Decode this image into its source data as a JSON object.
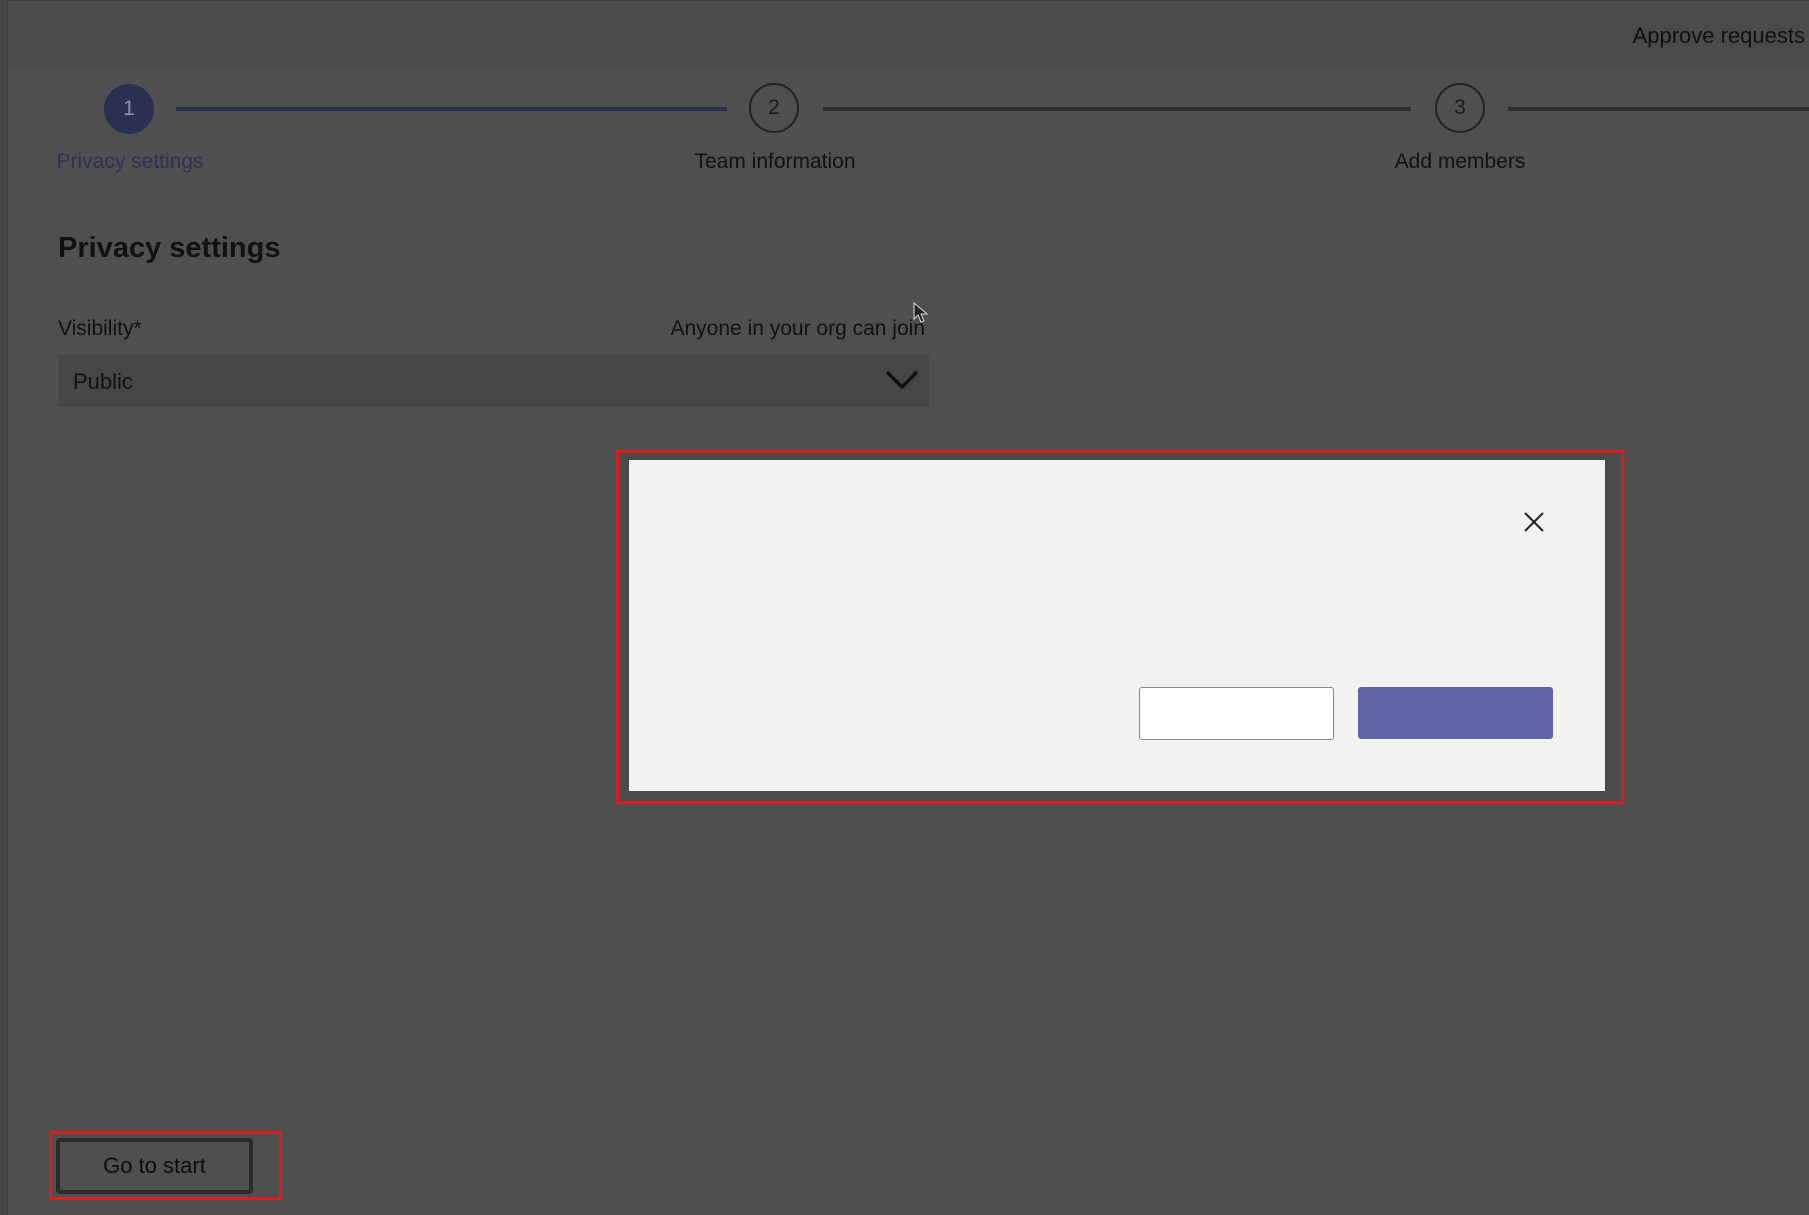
{
  "header": {
    "title": "Approve requests"
  },
  "stepper": {
    "steps": [
      {
        "number": "1",
        "label": "Privacy settings",
        "state": "active"
      },
      {
        "number": "2",
        "label": "Team information",
        "state": "inactive"
      },
      {
        "number": "3",
        "label": "Add members",
        "state": "inactive"
      }
    ]
  },
  "privacy": {
    "section_title": "Privacy settings",
    "visibility_label": "Visibility*",
    "visibility_hint": "Anyone in your org can join",
    "visibility_value": "Public",
    "dropdown_icon": "chevron-down-icon"
  },
  "dialog": {
    "close_icon": "close-icon",
    "secondary_button_label": "",
    "primary_button_label": ""
  },
  "footer": {
    "go_to_start_label": "Go to start"
  },
  "colors": {
    "accent": "#6264a7",
    "active_step": "#2b2f52",
    "highlight": "#d81e1e",
    "dialog_bg": "#f3f2f1"
  }
}
